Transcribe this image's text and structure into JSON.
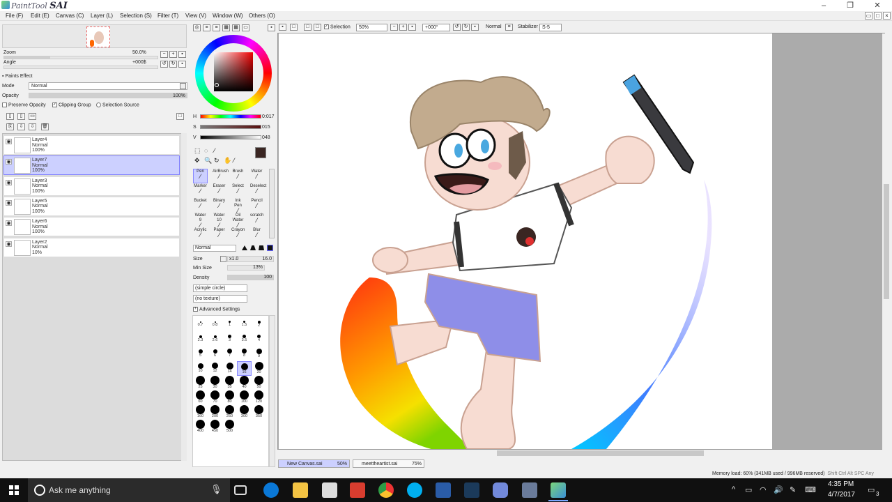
{
  "app": {
    "title_small": "PaintTool",
    "title_big": "SAI"
  },
  "menu": [
    "File (F)",
    "Edit (E)",
    "Canvas (C)",
    "Layer (L)",
    "Selection (S)",
    "Filter (T)",
    "View (V)",
    "Window (W)",
    "Others (O)"
  ],
  "navigator": {
    "zoom_label": "Zoom",
    "zoom_value": "50.0%",
    "angle_label": "Angle",
    "angle_value": "+000$",
    "zoom_level": 0.3
  },
  "paints_effect": {
    "title": "Paints Effect",
    "mode_label": "Mode",
    "mode_value": "Normal",
    "opacity_label": "Opacity",
    "opacity_value": "100%",
    "opacity_level": 1.0,
    "preserve_opacity": "Preserve Opacity",
    "clipping_group": "Clipping Group",
    "selection_source": "Selection Source"
  },
  "layers": [
    {
      "name": "Layer4",
      "mode": "Normal",
      "opacity": "100%"
    },
    {
      "name": "Layer7",
      "mode": "Normal",
      "opacity": "100%",
      "selected": true
    },
    {
      "name": "Layer3",
      "mode": "Normal",
      "opacity": "100%"
    },
    {
      "name": "Layer5",
      "mode": "Normal",
      "opacity": "100%"
    },
    {
      "name": "Layer6",
      "mode": "Normal",
      "opacity": "100%"
    },
    {
      "name": "Layer2",
      "mode": "Normal",
      "opacity": "10%"
    }
  ],
  "color": {
    "h_label": "H",
    "h_value": "0:017",
    "s_label": "S",
    "s_value": "015",
    "v_label": "V",
    "v_value": "048",
    "current": "#3a2622"
  },
  "tools": [
    [
      "Pen",
      "AirBrush",
      "Brush",
      "Water"
    ],
    [
      "Marker",
      "Eraser",
      "Select",
      "Deselect"
    ],
    [
      "Bucket",
      "Binary",
      "Ink Pen",
      "Pencil"
    ],
    [
      "Water 9",
      "Water 10",
      "Oil Water",
      "scratch"
    ],
    [
      "Acrylic",
      "Paper",
      "Crayon",
      "Blur"
    ]
  ],
  "brush": {
    "blend_mode": "Normal",
    "size_label": "Size",
    "size_mult": "x1.0",
    "size_value": "16.0",
    "min_size_label": "Min Size",
    "min_size_value": "13%",
    "density_label": "Density",
    "density_value": "100",
    "shape": "(simple circle)",
    "texture": "(no texture)",
    "advanced": "Advanced Settings",
    "sizes": [
      "0.7",
      "0.8",
      "1",
      "1.5",
      "2",
      "2.3",
      "2.6",
      "3",
      "3.5",
      "4",
      "5",
      "6",
      "7",
      "8",
      "9",
      "10",
      "12",
      "14",
      "16",
      "20",
      "25",
      "30",
      "35",
      "40",
      "50",
      "60",
      "70",
      "80",
      "100",
      "120",
      "160",
      "200",
      "250",
      "300",
      "350",
      "400",
      "450",
      "500"
    ],
    "selected_size": "16"
  },
  "canvas_toolbar": {
    "selection": "Selection",
    "zoom": "50%",
    "angle": "+000°",
    "blend": "Normal",
    "stabilizer_label": "Stabilizer",
    "stabilizer": "S-5"
  },
  "canvas_tabs": [
    {
      "name": "New Canvas.sai",
      "zoom": "50%"
    },
    {
      "name": "meettheartist.sai",
      "zoom": "75%"
    }
  ],
  "status": {
    "memory": "Memory load: 60% (341MB used / 996MB reserved)",
    "keys": "Shift Ctrl Alt SPC Any"
  },
  "taskbar": {
    "search_placeholder": "Ask me anything",
    "time": "4:35 PM",
    "date": "4/7/2017",
    "notifications": "3"
  }
}
